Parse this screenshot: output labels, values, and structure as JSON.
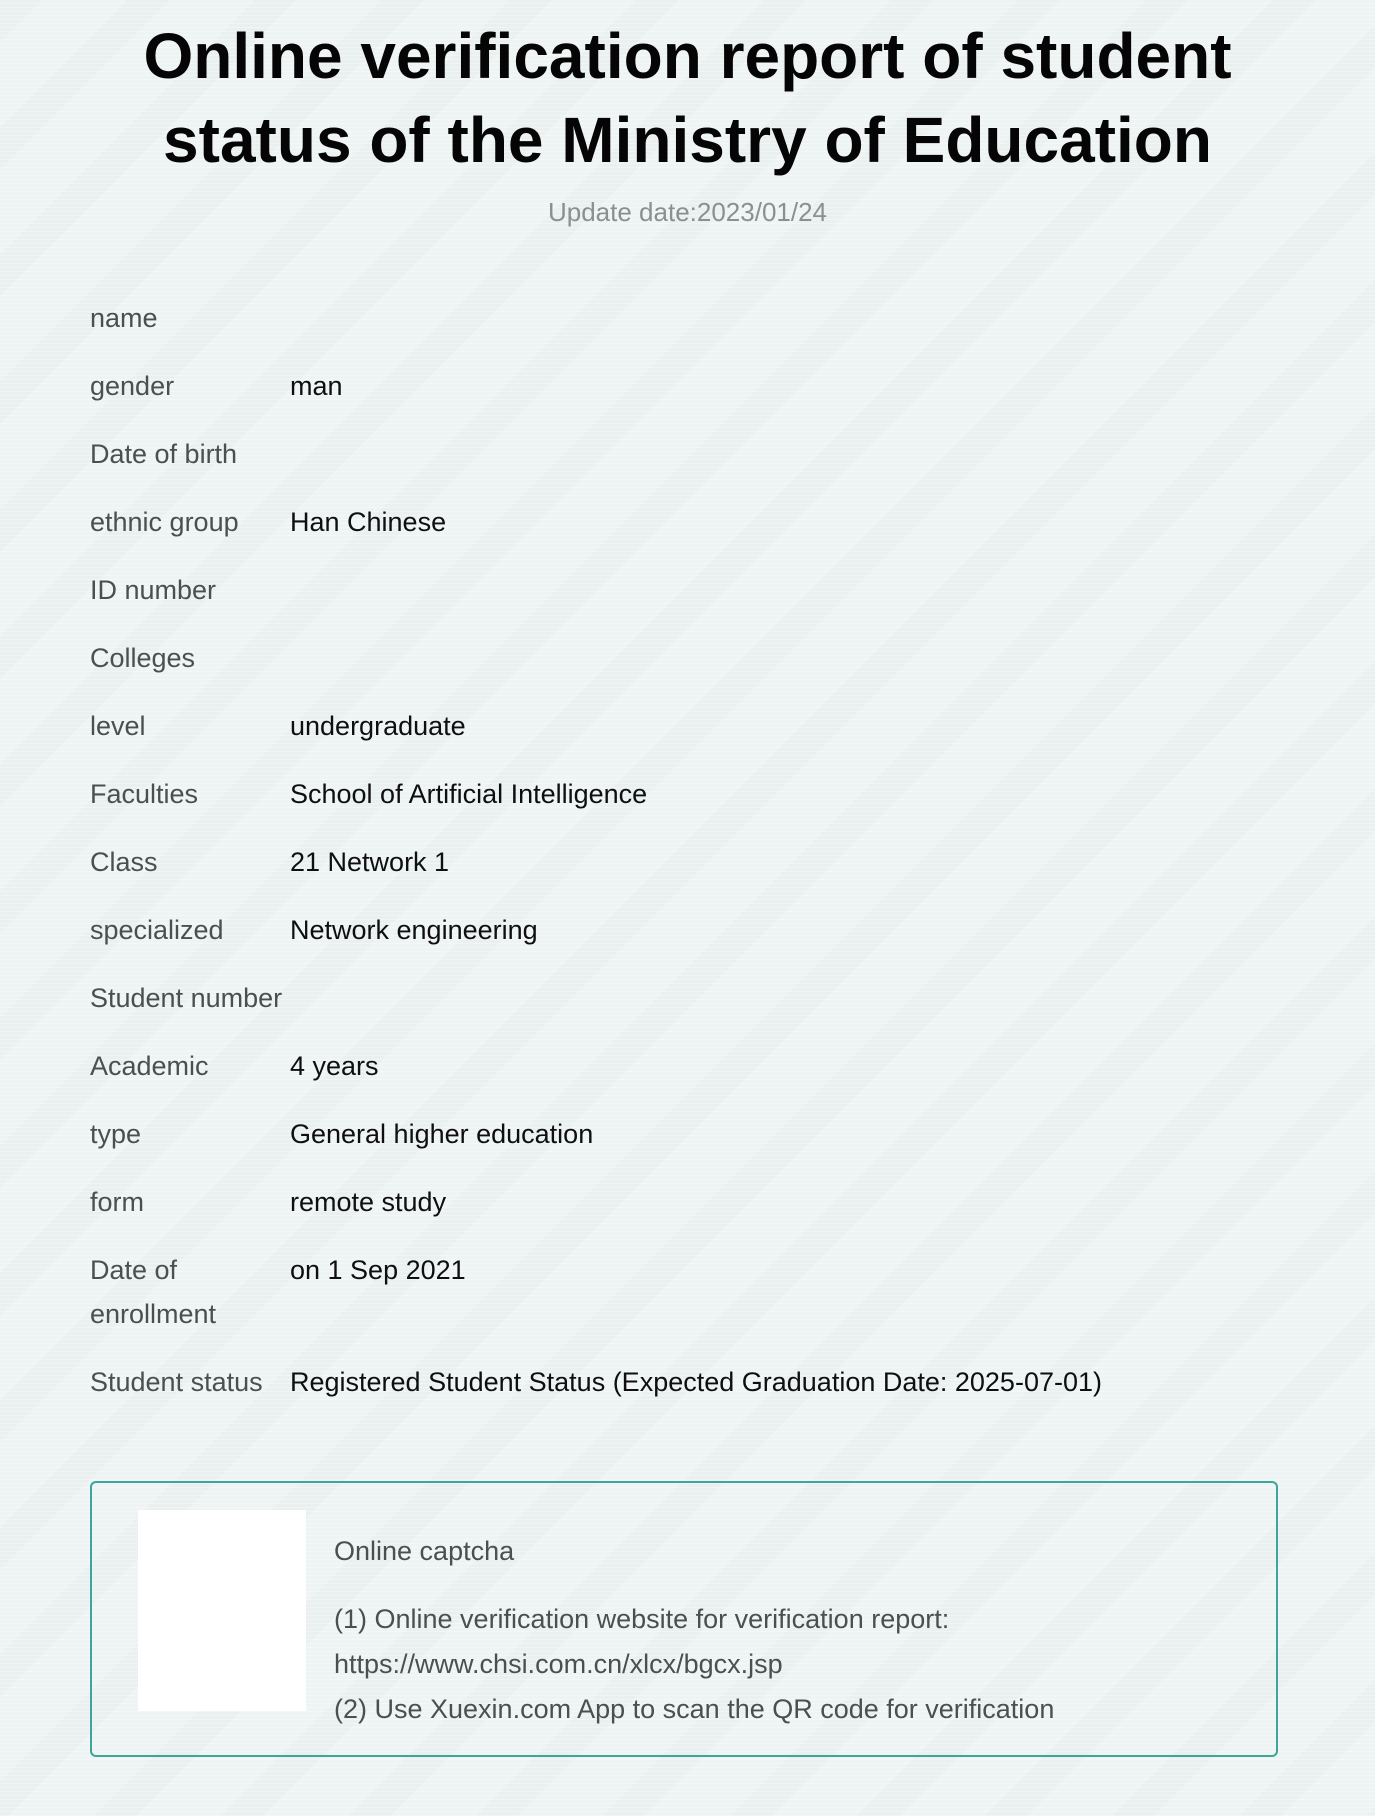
{
  "header": {
    "title_line1": "Online verification report of student",
    "title_line2": "status of the Ministry of Education",
    "update_date": "Update date:2023/01/24"
  },
  "fields": [
    {
      "label": "name",
      "value": ""
    },
    {
      "label": "gender",
      "value": "man"
    },
    {
      "label": "Date of birth",
      "value": ""
    },
    {
      "label": "ethnic group",
      "value": "Han Chinese"
    },
    {
      "label": "ID number",
      "value": ""
    },
    {
      "label": "Colleges",
      "value": ""
    },
    {
      "label": "level",
      "value": "undergraduate"
    },
    {
      "label": "Faculties",
      "value": "School of Artificial Intelligence"
    },
    {
      "label": "Class",
      "value": "21 Network 1"
    },
    {
      "label": "specialized",
      "value": "Network engineering"
    },
    {
      "label": "Student number",
      "value": ""
    },
    {
      "label": "Academic",
      "value": "4 years"
    },
    {
      "label": "type",
      "value": "General higher education"
    },
    {
      "label": "form",
      "value": "remote study"
    },
    {
      "label_line1": "Date of",
      "label_line2": "enrollment",
      "value": "on 1 Sep 2021"
    },
    {
      "label": "Student status",
      "value": "Registered Student Status (Expected Graduation Date: 2025-07-01)"
    }
  ],
  "verification": {
    "title": "Online captcha",
    "line1": "(1) Online verification website for verification report:",
    "line2": "https://www.chsi.com.cn/xlcx/bgcx.jsp",
    "line3": "(2) Use Xuexin.com App to scan the QR code for verification",
    "border_color": "#3aa79a"
  }
}
